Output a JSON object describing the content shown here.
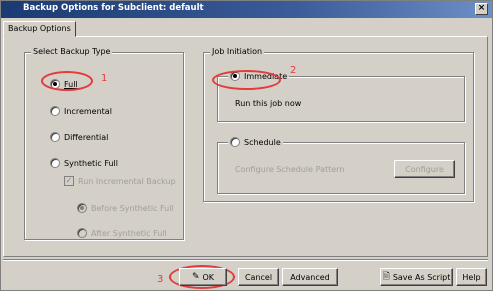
{
  "window": {
    "title": "Backup Options for Subclient: default",
    "close_glyph": "×"
  },
  "tabs": [
    {
      "label": "Backup Options"
    }
  ],
  "backup_type": {
    "group_label": "Select Backup Type",
    "options": [
      {
        "label": "Full",
        "selected": true,
        "enabled": true
      },
      {
        "label": "Incremental",
        "selected": false,
        "enabled": true
      },
      {
        "label": "Differential",
        "selected": false,
        "enabled": true
      },
      {
        "label": "Synthetic Full",
        "selected": false,
        "enabled": true
      }
    ],
    "run_incremental": {
      "label": "Run Incremental Backup",
      "checked": true,
      "enabled": false
    },
    "synthetic_timing": [
      {
        "label": "Before Synthetic Full",
        "selected": true,
        "enabled": false
      },
      {
        "label": "After Synthetic Full",
        "selected": false,
        "enabled": false
      }
    ]
  },
  "job_initiation": {
    "group_label": "Job Initiation",
    "immediate": {
      "label": "Immediate",
      "selected": true,
      "description": "Run this job now"
    },
    "schedule": {
      "label": "Schedule",
      "selected": false,
      "pattern_label": "Configure Schedule Pattern",
      "configure_button": "Configure"
    }
  },
  "buttons": {
    "ok": {
      "label": "OK",
      "icon": "ok-icon"
    },
    "cancel": {
      "label": "Cancel"
    },
    "advanced": {
      "label": "Advanced"
    },
    "save_as_script": {
      "label": "Save As Script",
      "icon": "script-icon"
    },
    "help": {
      "label": "Help"
    }
  },
  "annotations": [
    {
      "label": "1"
    },
    {
      "label": "2"
    },
    {
      "label": "3"
    }
  ],
  "colors": {
    "title_bar": "#1b3a73",
    "dialog_bg": "#d4d0c8",
    "annotation": "#e23b3b"
  }
}
